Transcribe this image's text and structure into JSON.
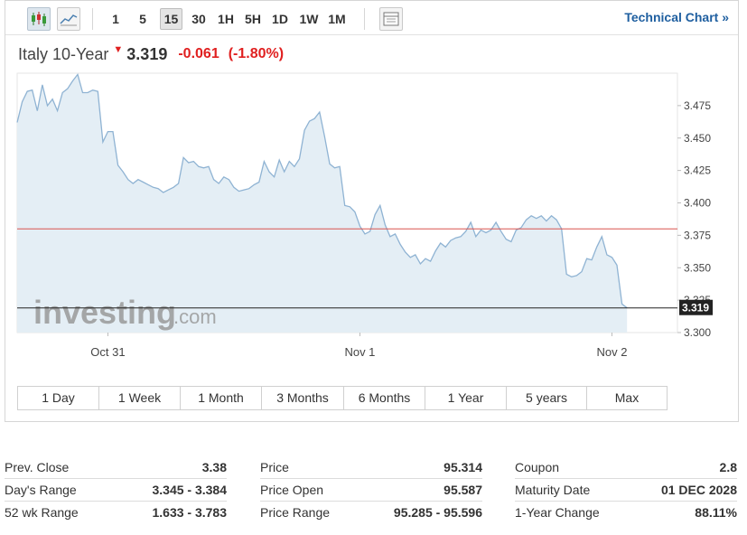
{
  "toolbar": {
    "intervals": [
      "1",
      "5",
      "15",
      "30",
      "1H",
      "5H",
      "1D",
      "1W",
      "1M"
    ],
    "active_interval": "15",
    "technical_chart": "Technical Chart »"
  },
  "header": {
    "name": "Italy 10-Year",
    "arrow": "▼",
    "price": "3.319",
    "change": "-0.061",
    "change_pct": "(-1.80%)"
  },
  "colors": {
    "line": "#8fb3d3",
    "area": "#e3edf4",
    "prev_close_line": "#d9534f",
    "current_line": "#222222",
    "negative": "#e02020",
    "link": "#1f5fa0"
  },
  "watermark": {
    "main": "investing",
    "suffix": ".com"
  },
  "chart_data": {
    "type": "area",
    "title": "",
    "xlabel": "",
    "ylabel": "",
    "ylim": [
      3.3,
      3.5
    ],
    "yticks": [
      "3.475",
      "3.450",
      "3.425",
      "3.400",
      "3.375",
      "3.350",
      "3.325",
      "3.300"
    ],
    "xticks": [
      {
        "label": "Oct 31",
        "t": 18
      },
      {
        "label": "Nov 1",
        "t": 68
      },
      {
        "label": "Nov 2",
        "t": 118
      }
    ],
    "xlim": [
      0,
      131
    ],
    "prev_close": 3.38,
    "last_value": "3.319",
    "series": [
      {
        "values": [
          3.462,
          3.478,
          3.486,
          3.487,
          3.471,
          3.491,
          3.475,
          3.48,
          3.471,
          3.485,
          3.488,
          3.494,
          3.499,
          3.485,
          3.485,
          3.487,
          3.486,
          3.447,
          3.455,
          3.455,
          3.429,
          3.424,
          3.418,
          3.415,
          3.418,
          3.416,
          3.414,
          3.412,
          3.411,
          3.408,
          3.41,
          3.412,
          3.415,
          3.435,
          3.431,
          3.432,
          3.428,
          3.427,
          3.428,
          3.418,
          3.415,
          3.42,
          3.418,
          3.412,
          3.409,
          3.41,
          3.411,
          3.414,
          3.416,
          3.432,
          3.424,
          3.42,
          3.433,
          3.424,
          3.432,
          3.428,
          3.434,
          3.456,
          3.463,
          3.465,
          3.47,
          3.451,
          3.43,
          3.427,
          3.428,
          3.398,
          3.397,
          3.393,
          3.382,
          3.376,
          3.378,
          3.391,
          3.398,
          3.383,
          3.374,
          3.376,
          3.368,
          3.362,
          3.358,
          3.36,
          3.353,
          3.357,
          3.355,
          3.363,
          3.369,
          3.366,
          3.371,
          3.373,
          3.374,
          3.378,
          3.385,
          3.374,
          3.379,
          3.377,
          3.379,
          3.385,
          3.378,
          3.372,
          3.37,
          3.379,
          3.381,
          3.387,
          3.39,
          3.388,
          3.39,
          3.386,
          3.39,
          3.387,
          3.38,
          3.345,
          3.343,
          3.344,
          3.347,
          3.357,
          3.356,
          3.366,
          3.374,
          3.36,
          3.358,
          3.352,
          3.322,
          3.319
        ]
      }
    ]
  },
  "ranges": [
    "1 Day",
    "1 Week",
    "1 Month",
    "3 Months",
    "6 Months",
    "1 Year",
    "5 years",
    "Max"
  ],
  "stats": [
    [
      {
        "label": "Prev. Close",
        "value": "3.38"
      },
      {
        "label": "Day's Range",
        "value": "3.345 - 3.384"
      },
      {
        "label": "52 wk Range",
        "value": "1.633 - 3.783"
      }
    ],
    [
      {
        "label": "Price",
        "value": "95.314"
      },
      {
        "label": "Price Open",
        "value": "95.587"
      },
      {
        "label": "Price Range",
        "value": "95.285 - 95.596"
      }
    ],
    [
      {
        "label": "Coupon",
        "value": "2.8"
      },
      {
        "label": "Maturity Date",
        "value": "01 DEC 2028"
      },
      {
        "label": "1-Year Change",
        "value": "88.11%"
      }
    ]
  ]
}
